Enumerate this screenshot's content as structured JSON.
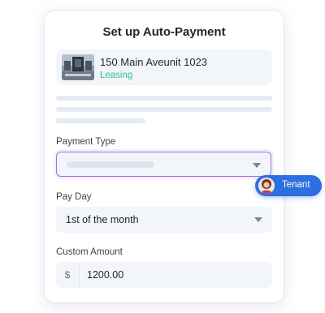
{
  "title": "Set up Auto-Payment",
  "property": {
    "name": "150 Main Aveunit 1023",
    "status": "Leasing",
    "thumbnail_icon": "property-photo"
  },
  "payment_type": {
    "label": "Payment Type",
    "value": ""
  },
  "pay_day": {
    "label": "Pay Day",
    "value": "1st of the month"
  },
  "custom_amount": {
    "label": "Custom Amount",
    "currency": "$",
    "value": "1200.00"
  },
  "cursor_badge": {
    "label": "Tenant",
    "color": "#2d6ee0"
  },
  "colors": {
    "accent": "#a66ee0",
    "status": "#2cbf8e"
  }
}
